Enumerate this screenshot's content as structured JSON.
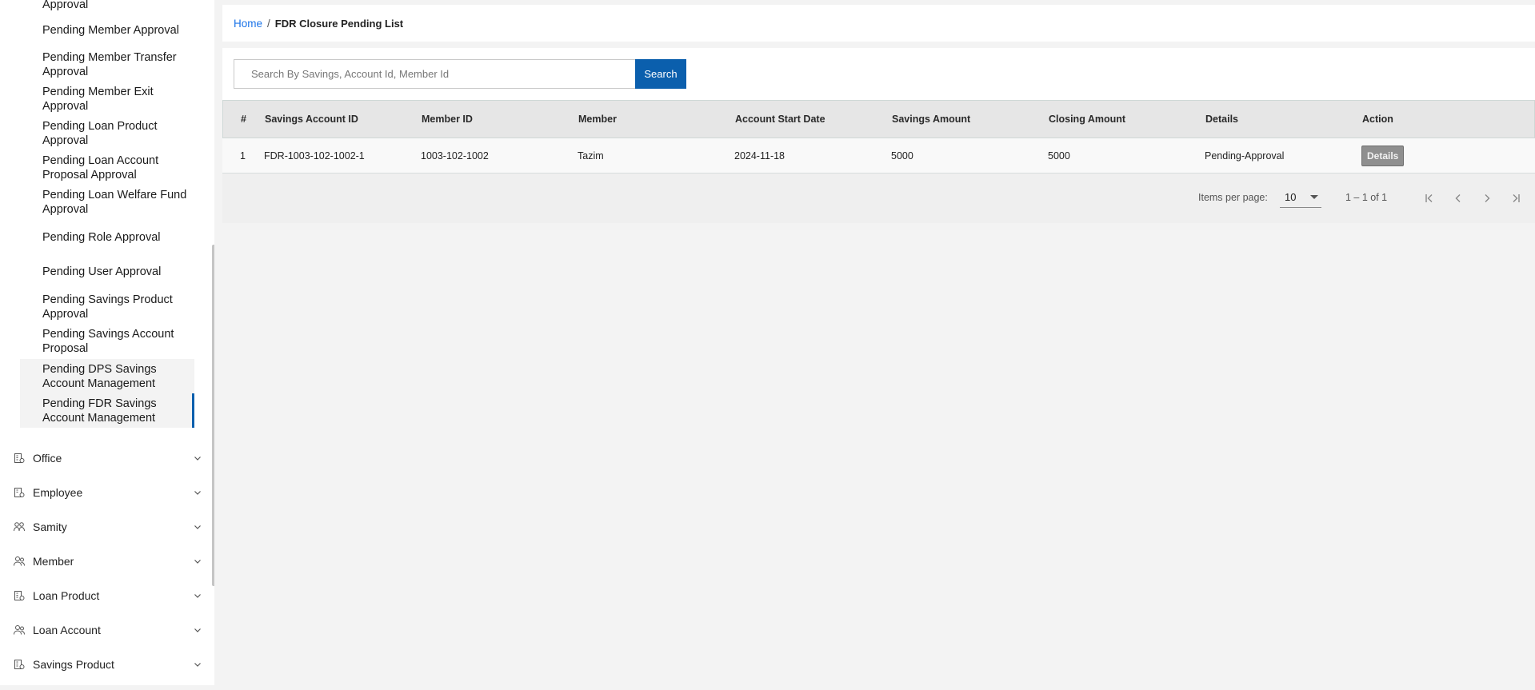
{
  "sidebar": {
    "sub_items": [
      {
        "label": "Approval"
      },
      {
        "label": "Pending Member Approval"
      },
      {
        "label": "Pending Member Transfer Approval"
      },
      {
        "label": "Pending Member Exit Approval"
      },
      {
        "label": "Pending Loan Product Approval"
      },
      {
        "label": "Pending Loan Account Proposal Approval"
      },
      {
        "label": "Pending Loan Welfare Fund Approval"
      },
      {
        "label": "Pending Role Approval"
      },
      {
        "label": "Pending User Approval"
      },
      {
        "label": "Pending Savings Product Approval"
      },
      {
        "label": "Pending Savings Account Proposal"
      },
      {
        "label": "Pending DPS Savings Account Management"
      },
      {
        "label": "Pending FDR Savings Account Management"
      }
    ],
    "menu": [
      {
        "label": "Office",
        "icon": "office-icon"
      },
      {
        "label": "Employee",
        "icon": "employee-icon"
      },
      {
        "label": "Samity",
        "icon": "samity-icon"
      },
      {
        "label": "Member",
        "icon": "member-icon"
      },
      {
        "label": "Loan Product",
        "icon": "loan-product-icon"
      },
      {
        "label": "Loan Account",
        "icon": "loan-account-icon"
      },
      {
        "label": "Savings Product",
        "icon": "savings-product-icon"
      }
    ]
  },
  "breadcrumb": {
    "home": "Home",
    "separator": "/",
    "current": "FDR Closure Pending List"
  },
  "search": {
    "placeholder": "Search By Savings, Account Id, Member Id",
    "button": "Search"
  },
  "table": {
    "headers": [
      "#",
      "Savings Account ID",
      "Member ID",
      "Member",
      "Account Start Date",
      "Savings Amount",
      "Closing Amount",
      "Details",
      "Action"
    ],
    "rows": [
      {
        "index": "1",
        "savings_account_id": "FDR-1003-102-1002-1",
        "member_id": "1003-102-1002",
        "member": "Tazim",
        "start_date": "2024-11-18",
        "savings_amount": "5000",
        "closing_amount": "5000",
        "details": "Pending-Approval",
        "action": "Details"
      }
    ]
  },
  "paginator": {
    "items_per_page_label": "Items per page:",
    "items_per_page": "10",
    "range": "1 – 1 of 1"
  },
  "colors": {
    "accent": "#0b5fad",
    "link": "#1a73e8"
  }
}
